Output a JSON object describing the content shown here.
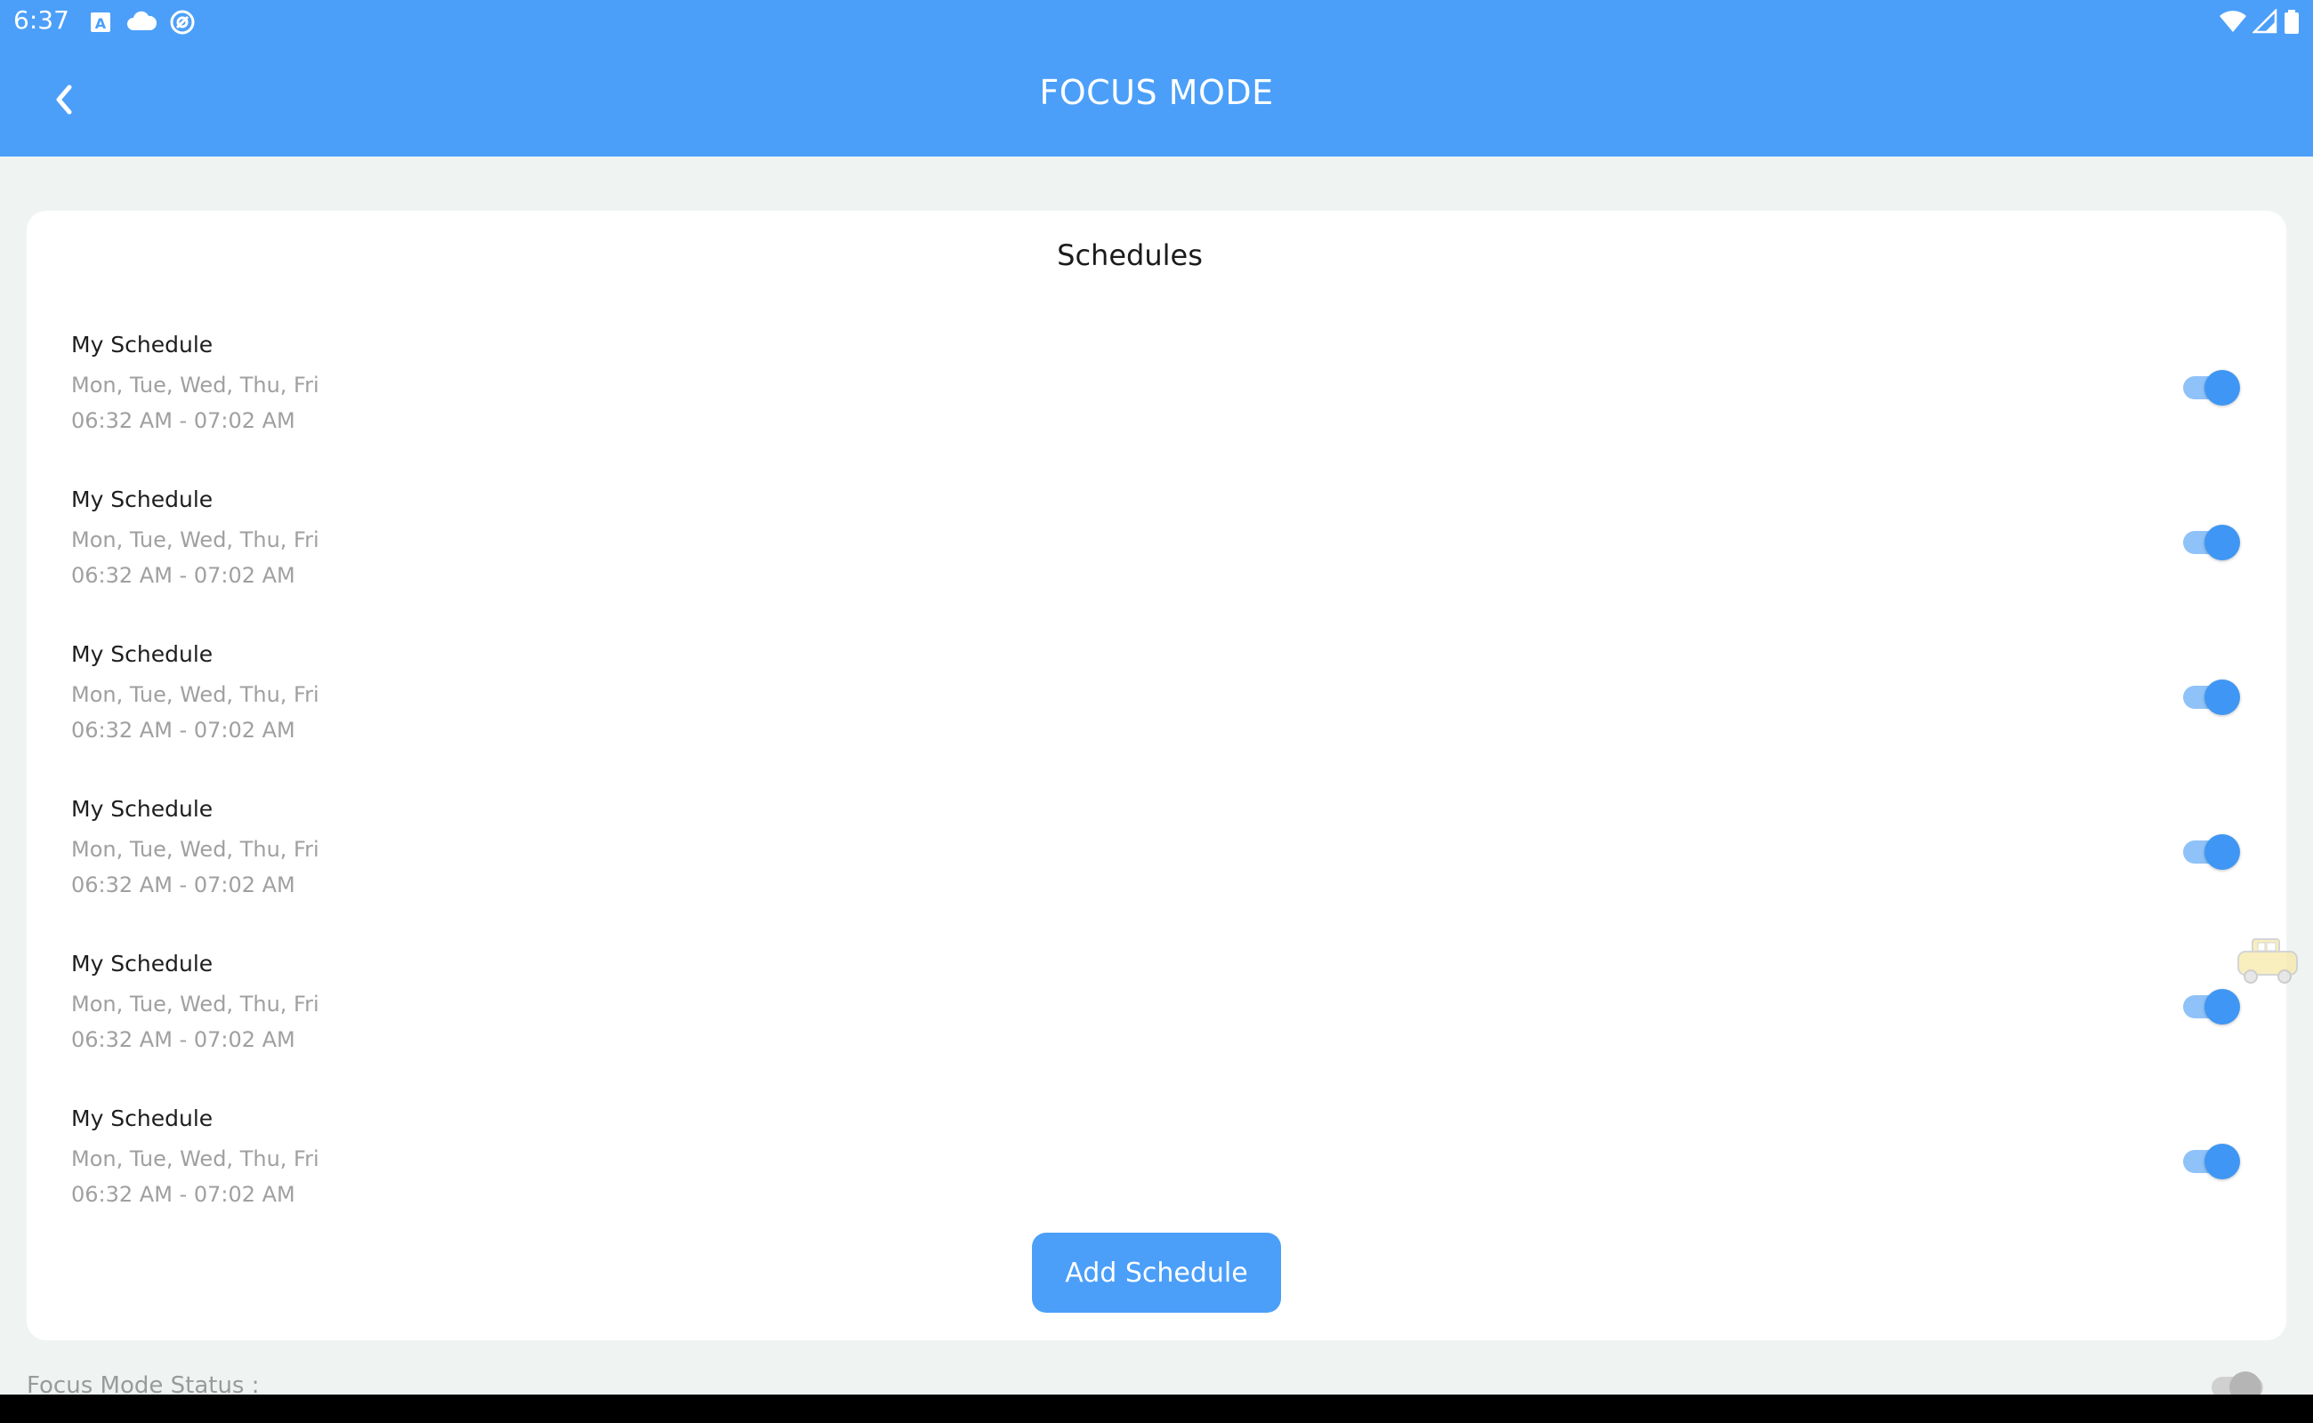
{
  "status_bar": {
    "time": "6:37"
  },
  "app_bar": {
    "title": "FOCUS MODE",
    "color": "#4b9ff9"
  },
  "schedules_card": {
    "title": "Schedules",
    "items": [
      {
        "name": "My Schedule",
        "days": "Mon, Tue, Wed, Thu, Fri",
        "time": "06:32 AM - 07:02 AM",
        "enabled": true
      },
      {
        "name": "My Schedule",
        "days": "Mon, Tue, Wed, Thu, Fri",
        "time": "06:32 AM - 07:02 AM",
        "enabled": true
      },
      {
        "name": "My Schedule",
        "days": "Mon, Tue, Wed, Thu, Fri",
        "time": "06:32 AM - 07:02 AM",
        "enabled": true
      },
      {
        "name": "My Schedule",
        "days": "Mon, Tue, Wed, Thu, Fri",
        "time": "06:32 AM - 07:02 AM",
        "enabled": true
      },
      {
        "name": "My Schedule",
        "days": "Mon, Tue, Wed, Thu, Fri",
        "time": "06:32 AM - 07:02 AM",
        "enabled": true
      },
      {
        "name": "My Schedule",
        "days": "Mon, Tue, Wed, Thu, Fri",
        "time": "06:32 AM - 07:02 AM",
        "enabled": true
      }
    ],
    "add_button_label": "Add Schedule"
  },
  "footer": {
    "status_label": "Focus Mode Status :",
    "status_enabled": false
  },
  "icons": {
    "back": "back-arrow-icon",
    "status_left": [
      "a-badge-icon",
      "cloud-icon",
      "at-sign-icon"
    ],
    "status_right": [
      "wifi-icon",
      "cell-signal-icon",
      "battery-icon"
    ],
    "floating": "taxi-icon"
  },
  "colors": {
    "accent": "#4b9ff9",
    "toggle_on": "#3f96f4",
    "background": "#eff4f3"
  }
}
